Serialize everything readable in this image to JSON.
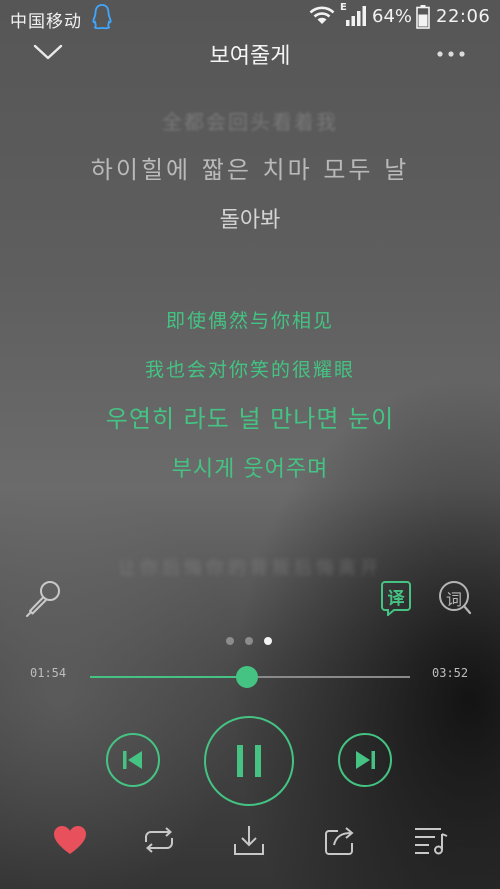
{
  "status_bar": {
    "carrier": "中国移动",
    "network_type": "E",
    "battery": "64%",
    "time": "22:06"
  },
  "header": {
    "title": "보여줄게"
  },
  "lyrics": {
    "faded_top": "全都会回头看着我",
    "previous_line_ko_1": "하이힐에 짧은 치마 모두 날",
    "previous_line_ko_2": "돌아봐",
    "current_translation_1": "即使偶然与你相见",
    "current_translation_2": "我也会对你笑的很耀眼",
    "current_line_ko_1": "우연히 라도 널 만나면 눈이",
    "current_line_ko_2": "부시게 웃어주며",
    "faded_bottom": "让你后悔你的背叛后悔离开"
  },
  "tools": {
    "translate_label": "译",
    "lyric_label": "词"
  },
  "pager": {
    "count": 3,
    "active_index": 2
  },
  "progress": {
    "current_time": "01:54",
    "total_time": "03:52",
    "fraction": 0.49
  },
  "colors": {
    "accent": "#44c383",
    "favorite": "#e8505b"
  },
  "icons": {
    "back": "chevron-down-icon",
    "more": "more-dots-icon",
    "mic": "microphone-icon",
    "prev": "skip-previous-icon",
    "play_pause": "pause-icon",
    "next": "skip-next-icon",
    "favorite": "heart-icon",
    "loop": "repeat-icon",
    "download": "download-icon",
    "share": "share-icon",
    "queue": "playlist-icon"
  }
}
